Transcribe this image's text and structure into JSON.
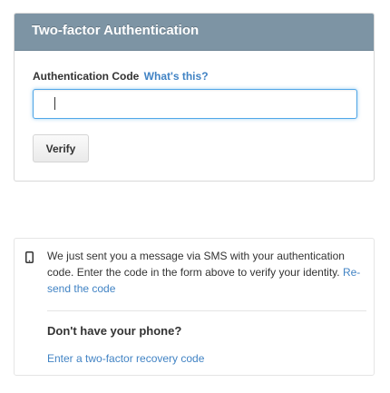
{
  "two_factor": {
    "header_title": "Two-factor Authentication",
    "code_label": "Authentication Code",
    "help_link": "What's this?",
    "code_input_value": "",
    "code_input_placeholder": "",
    "verify_label": "Verify"
  },
  "sms_notice": {
    "icon": "mobile-phone-icon",
    "message": "We just sent you a message via SMS with your authentication code. Enter the code in the form above to verify your identity.",
    "resend_link": "Re-send the code",
    "no_phone_title": "Don't have your phone?",
    "recovery_link": "Enter a two-factor recovery code"
  },
  "colors": {
    "header_bg": "#7d94a4",
    "link": "#4183c4",
    "input_focus": "#51a7e8"
  }
}
